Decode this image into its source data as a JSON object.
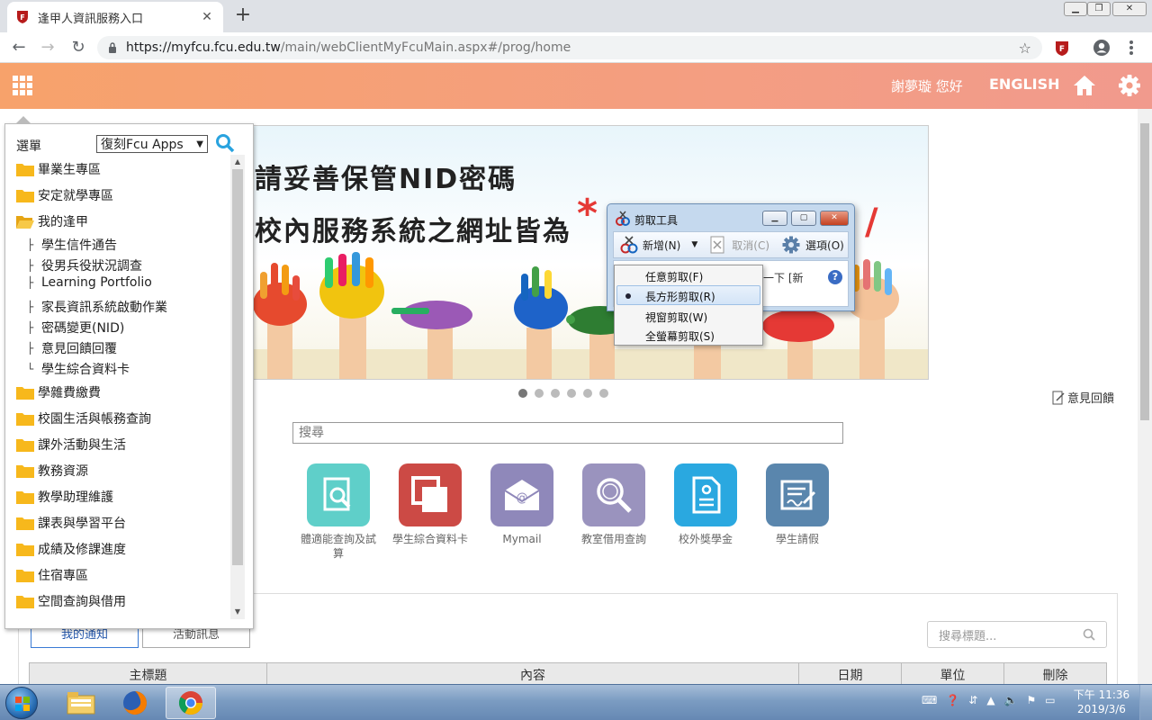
{
  "browser": {
    "tab_title": "逢甲人資訊服務入口",
    "tab_close": "✕",
    "new_tab": "+",
    "url_host": "https://myfcu.fcu.edu.tw",
    "url_path": "/main/webClientMyFcuMain.aspx#/prog/home",
    "back": "←",
    "forward": "→",
    "reload": "↻",
    "star": "☆"
  },
  "header": {
    "greeting": "謝夢璇 您好",
    "language_link": "ENGLISH"
  },
  "banner": {
    "line1": "請妥善保管NID密碼",
    "line2": "校內服務系統之網址皆為",
    "asterisk": "*",
    "slash": "/",
    "dots": 6,
    "active_dot": 0
  },
  "feedback": "意見回饋",
  "search": {
    "placeholder": "搜尋"
  },
  "tiles": [
    {
      "label": "體適能查詢及試算",
      "icon": "fitness-search-icon",
      "color": "#5fcfc9"
    },
    {
      "label": "學生綜合資料卡",
      "icon": "data-card-icon",
      "color": "#cc4a45"
    },
    {
      "label": "Mymail",
      "icon": "mail-icon",
      "color": "#8f88ba"
    },
    {
      "label": "教室借用查詢",
      "icon": "classroom-search-icon",
      "color": "#9a93be"
    },
    {
      "label": "校外獎學金",
      "icon": "scholarship-document-icon",
      "color": "#2aa8e0"
    },
    {
      "label": "學生請假",
      "icon": "leave-request-icon",
      "color": "#5a86ad"
    }
  ],
  "notices": {
    "tabs": [
      "我的通知",
      "活動訊息"
    ],
    "search_placeholder": "搜尋標題...",
    "columns": [
      "主標題",
      "內容",
      "日期",
      "單位",
      "刪除"
    ]
  },
  "menu": {
    "label": "選單",
    "select_value": "復刻Fcu Apps",
    "folders_before": [
      "畢業生專區",
      "安定就學專區",
      "我的逢甲"
    ],
    "children": [
      "學生信件通告",
      "役男兵役狀況調查",
      "Learning Portfolio",
      "家長資訊系統啟動作業",
      "密碼變更(NID)",
      "意見回饋回覆",
      "學生綜合資料卡"
    ],
    "folders_after": [
      "學雜費繳費",
      "校園生活與帳務查詢",
      "課外活動與生活",
      "教務資源",
      "教學助理維護",
      "課表與學習平台",
      "成績及修課進度",
      "住宿專區",
      "空間查詢與借用"
    ]
  },
  "snipping_tool": {
    "title": "剪取工具",
    "new_label": "新增(N)",
    "cancel_label": "取消(C)",
    "options_label": "選項(O)",
    "description_fragment": "一下 [新",
    "help": "?",
    "menu_items": [
      "任意剪取(F)",
      "長方形剪取(R)",
      "視窗剪取(W)",
      "全螢幕剪取(S)"
    ],
    "selected_index": 1
  },
  "taskbar": {
    "time": "下午 11:36",
    "date": "2019/3/6"
  }
}
